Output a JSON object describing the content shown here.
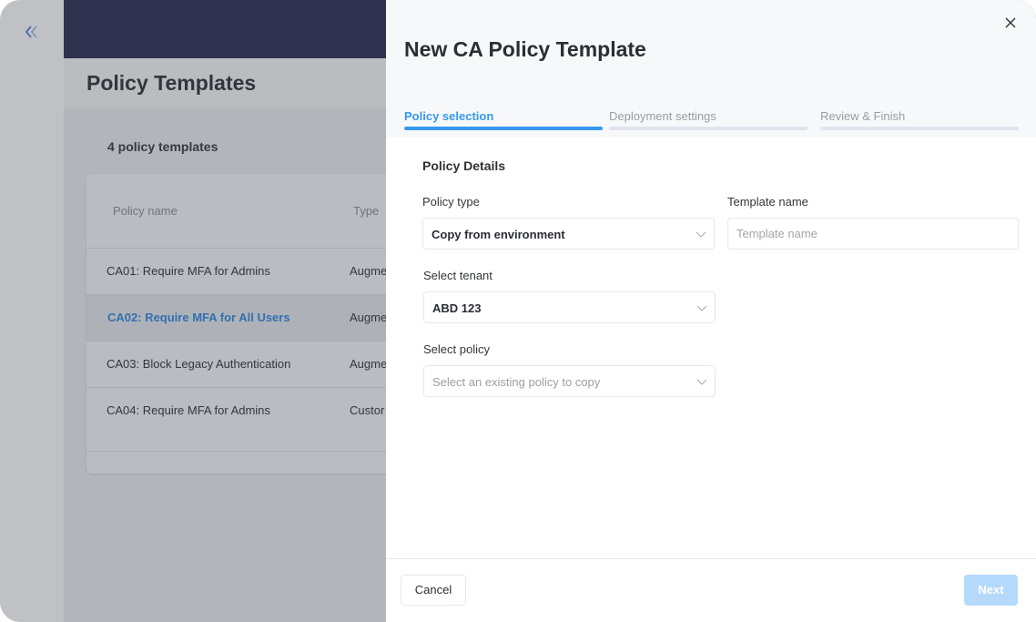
{
  "background_page": {
    "title": "Policy Templates",
    "count_label": "4 policy templates",
    "table": {
      "columns": [
        "Policy name",
        "Type"
      ],
      "rows": [
        {
          "name": "CA01: Require MFA for Admins",
          "type": "Augme"
        },
        {
          "name": "CA02: Require MFA for All Users",
          "type": "Augme"
        },
        {
          "name": "CA03: Block Legacy Authentication",
          "type": "Augme"
        },
        {
          "name": "CA04: Require MFA for Admins",
          "type": "Custor"
        }
      ]
    },
    "sidebar_icon": "double-chevron-left-icon"
  },
  "drawer": {
    "title": "New CA Policy Template",
    "close_icon": "close-icon",
    "steps": [
      {
        "label": "Policy selection",
        "state": "active"
      },
      {
        "label": "Deployment settings",
        "state": "pending"
      },
      {
        "label": "Review & Finish",
        "state": "pending"
      }
    ],
    "section_title": "Policy Details",
    "fields": {
      "policy_type": {
        "label": "Policy type",
        "value": "Copy from environment"
      },
      "template_name": {
        "label": "Template name",
        "value": "",
        "placeholder": "Template name"
      },
      "select_tenant": {
        "label": "Select tenant",
        "value": "ABD 123"
      },
      "select_policy": {
        "label": "Select policy",
        "value": "",
        "placeholder": "Select an existing policy to copy"
      }
    },
    "footer": {
      "cancel_label": "Cancel",
      "next_label": "Next",
      "next_disabled": true
    }
  },
  "colors": {
    "accent": "#3699f0",
    "topbar": "#2a2b52",
    "next_disabled_bg": "#b5d9fb",
    "link": "#2f86e0"
  }
}
